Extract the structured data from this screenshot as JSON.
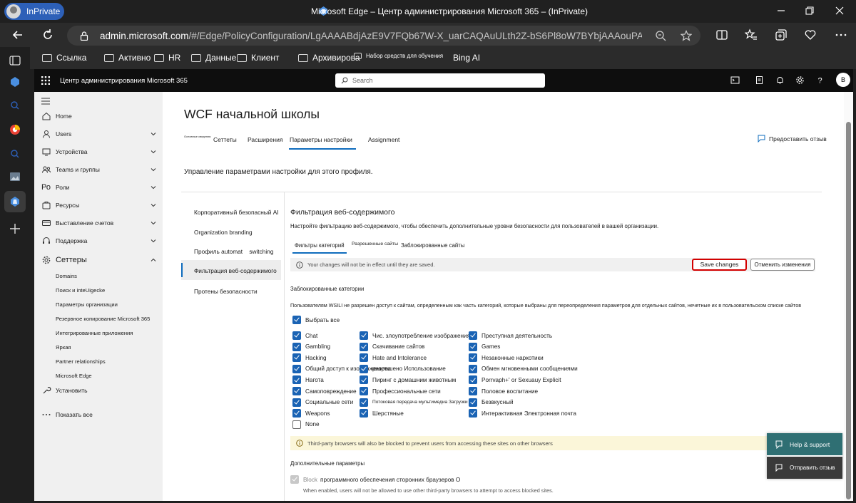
{
  "browser": {
    "inprivate_label": "InPrivate",
    "window_title": "Microsoft Edge – Центр администрирования Microsoft 365 – (InPrivate)",
    "url_host": "admin.microsoft.com",
    "url_path": "/#/Edge/PolicyConfiguration/LgAAAABdjAzE9V7FQb67W-X_uarCAQAuULth2Z-bS6Pl8oW7BYbjAAAouPAyAAA..."
  },
  "favorites": [
    {
      "label": "Ссылка"
    },
    {
      "label": "Активно"
    },
    {
      "label": "HR"
    },
    {
      "label": "Данные"
    },
    {
      "label": "Клиент"
    },
    {
      "label": "Архивирова"
    },
    {
      "label": "Набор средств для обучения"
    },
    {
      "label": "Bing AI"
    }
  ],
  "suite": {
    "title": "Центр администрирования Microsoft 365",
    "search_placeholder": "Search",
    "user_initial": "B"
  },
  "nav": {
    "items": [
      {
        "label": "Home"
      },
      {
        "label": "Users"
      },
      {
        "label": "Устройства"
      },
      {
        "label": "Teams и группы"
      },
      {
        "label": "Роли"
      },
      {
        "label": "Ресурсы"
      },
      {
        "label": "Выставление счетов"
      },
      {
        "label": "Поддержка"
      },
      {
        "label": "Сеттеры"
      }
    ],
    "roles_prefix": "Ро",
    "settings_sub": [
      {
        "label": "Domains"
      },
      {
        "label": "Поиск и inteUigecke"
      },
      {
        "label": "Параметры организации"
      },
      {
        "label": "Резервное копирование Microsoft 365"
      },
      {
        "label": "Интегрированные приложения"
      },
      {
        "label": "Яркая"
      },
      {
        "label": "Partner relationships"
      },
      {
        "label": "Microsoft Edge"
      }
    ],
    "install": "Установить",
    "show_all": "Показать все"
  },
  "page": {
    "title": "WCF начальной школы",
    "tabs": [
      {
        "label": "Основные сведения"
      },
      {
        "label": "Сеттеты"
      },
      {
        "label": "Расширения"
      },
      {
        "label": "Параметры настройки"
      },
      {
        "label": "Assignment"
      }
    ],
    "feedback": "Предоставить отзыв",
    "subtitle": "Управление параметрами настройки для этого профиля."
  },
  "left_nav": [
    {
      "label": "Корпоративный безопасный AI"
    },
    {
      "label": "Organization branding"
    },
    {
      "label": "Профиль automat    switching"
    },
    {
      "label": "Фильтрация веб-содержимого"
    },
    {
      "label": "Протены безопасности"
    }
  ],
  "section": {
    "title": "Фильтрация веб-содержимого",
    "desc": "Настройте фильтрацию веб-содержимого, чтобы обеспечить дополнительные уровни безопасности для пользователей в вашей организации.",
    "subtabs": [
      {
        "label": "Фильтры категорий"
      },
      {
        "label": "Разрешенные сайты"
      },
      {
        "label": "Заблокированные сайты"
      }
    ],
    "notice": "Your changes will not be in effect until they are saved.",
    "save": "Save changes",
    "cancel": "Отменить изменения",
    "blocked_title": "Заблокированные категории",
    "blocked_desc": "Пользователям WSILI не разрешен доступ к сайтам, определенным как часть категорий, которые выбраны для переопределения параметров для отдельных сайтов, нечетные их в пользовательском списке сайтов",
    "select_all": "Выбрать все",
    "col1": [
      {
        "label": "Chat",
        "checked": true
      },
      {
        "label": "Gambling",
        "checked": true
      },
      {
        "label": "Hacking",
        "checked": true
      },
      {
        "label": "Общий доступ к изображениям",
        "checked": true
      },
      {
        "label": "Нагота",
        "checked": true
      },
      {
        "label": "Самоповреждение",
        "checked": true
      },
      {
        "label": "Социальные сети",
        "checked": true
      },
      {
        "label": "Weapons",
        "checked": true
      },
      {
        "label": "None",
        "checked": false
      }
    ],
    "col2": [
      {
        "label": "Чис. злоупотребление изображения",
        "checked": true
      },
      {
        "label": "Скачивание сайтов",
        "checked": true
      },
      {
        "label": "Hate and Intolerance",
        "checked": true
      },
      {
        "label": "разрешено  Использование",
        "checked": true
      },
      {
        "label": "Пиринг с домашним животным",
        "checked": true
      },
      {
        "label": "Профессиональные сети",
        "checked": true
      },
      {
        "label": "Потоковая передача мультимедиа Загрузки",
        "checked": true
      },
      {
        "label": "Шерстяные",
        "checked": true
      }
    ],
    "col3": [
      {
        "label": "Преступная деятельность",
        "checked": true
      },
      {
        "label": "Games",
        "checked": true
      },
      {
        "label": "Незаконные наркотики",
        "checked": true
      },
      {
        "label": "Обмен мгновенными сообщениями",
        "checked": true
      },
      {
        "label": "Porrvaph+' or Sexuauy Explicit",
        "checked": true
      },
      {
        "label": "Половое воспитание",
        "checked": true
      },
      {
        "label": "Безвкусный",
        "checked": true
      },
      {
        "label": "Интерактивная Электронная почта",
        "checked": true
      }
    ],
    "warning": "Third-party browsers will also be blocked to prevent users from accessing these sites on other browsers",
    "additional": "Дополнительные параметры",
    "block_label": "Block",
    "block_rest": "программного обеспечения сторонних браузеров О",
    "block_hint": "When enabled, users will not be allowed to use other third-party browsers to attempt to access blocked sites."
  },
  "help": {
    "support": "Help & support",
    "feedback": "Отправить отзыв"
  },
  "colors": {
    "accent": "#0f6cbd",
    "save_outline": "#d30000",
    "checkbox": "#1a63b4",
    "help": "#2f6f73"
  }
}
